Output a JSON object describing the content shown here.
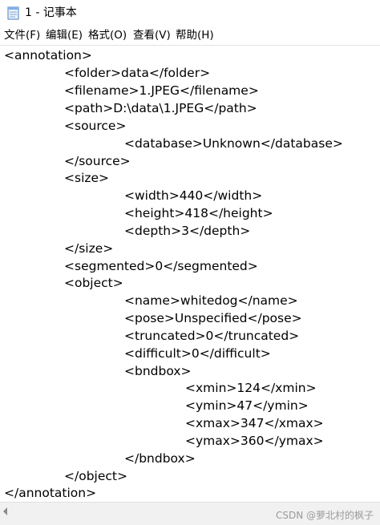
{
  "window": {
    "title": "1 - 记事本",
    "icon": "notepad-icon"
  },
  "menu": [
    {
      "label": "文件(F)"
    },
    {
      "label": "编辑(E)"
    },
    {
      "label": "格式(O)"
    },
    {
      "label": "查看(V)"
    },
    {
      "label": "帮助(H)"
    }
  ],
  "document": {
    "lines": [
      "<annotation>",
      "<folder>data</folder>",
      "<filename>1.JPEG</filename>",
      "<path>D:\\data\\1.JPEG</path>",
      "<source>",
      "<database>Unknown</database>",
      "</source>",
      "<size>",
      "<width>440</width>",
      "<height>418</height>",
      "<depth>3</depth>",
      "</size>",
      "<segmented>0</segmented>",
      "<object>",
      "<name>whitedog</name>",
      "<pose>Unspecified</pose>",
      "<truncated>0</truncated>",
      "<difficult>0</difficult>",
      "<bndbox>",
      "<xmin>124</xmin>",
      "<ymin>47</ymin>",
      "<xmax>347</xmax>",
      "<ymax>360</ymax>",
      "</bndbox>",
      "</object>",
      "</annotation>"
    ]
  },
  "footer": {
    "watermark": "CSDN @萝北村的枫子"
  },
  "colors": {
    "background": "#ffffff",
    "text": "#000000",
    "scrollbar": "#f1f1f1"
  }
}
